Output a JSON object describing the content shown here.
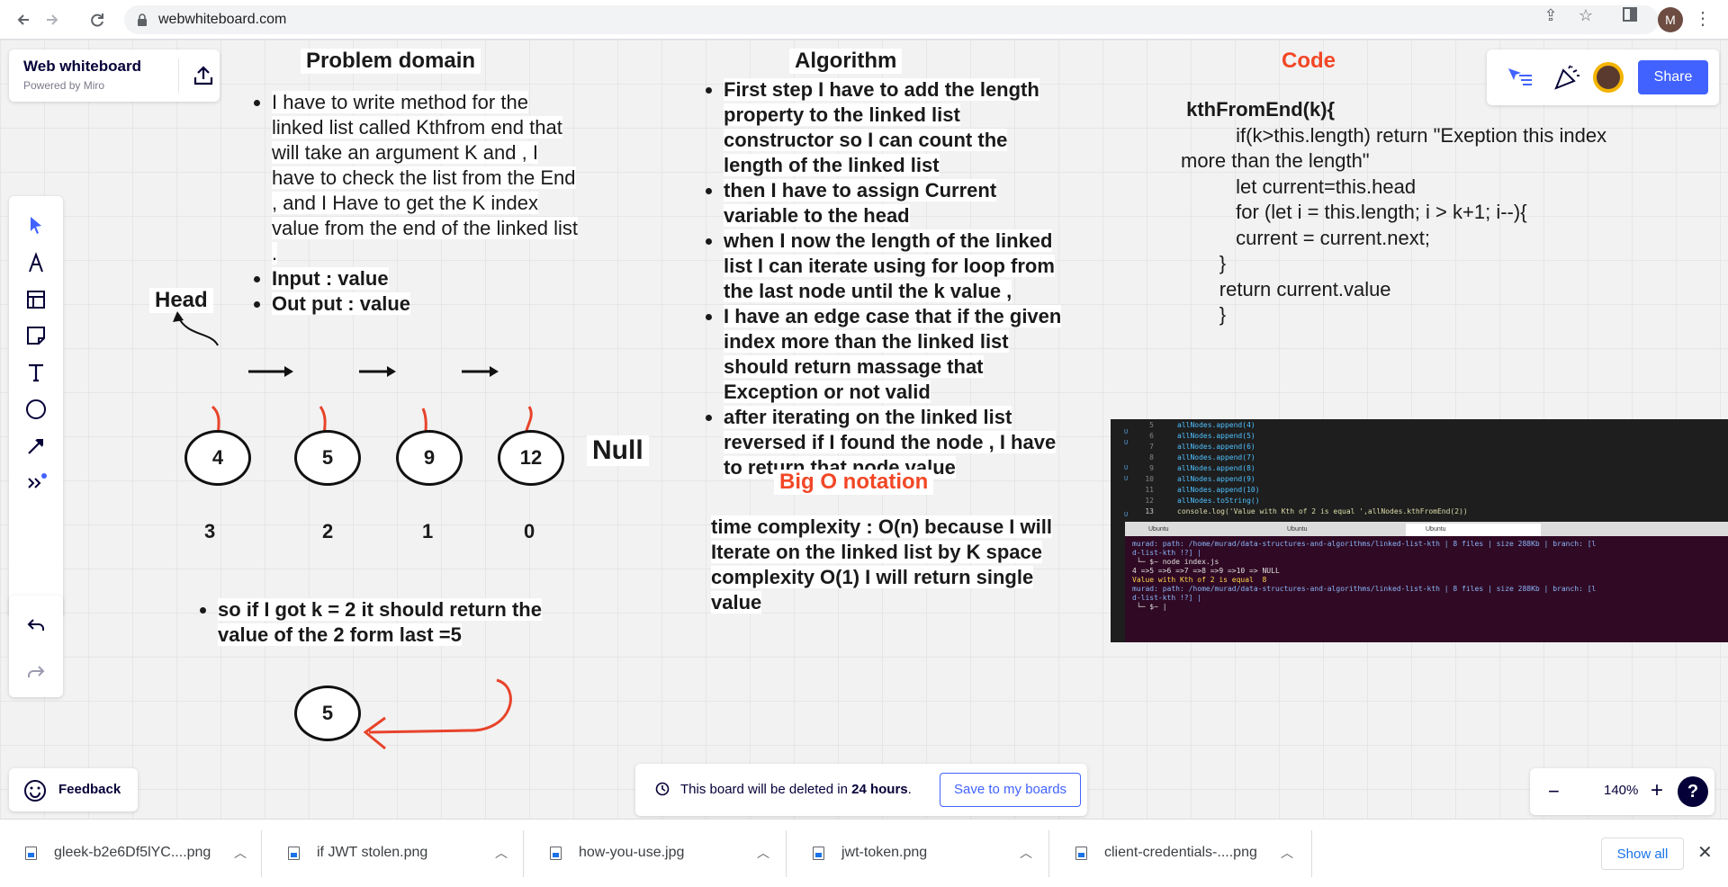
{
  "browser": {
    "url": "webwhiteboard.com",
    "profile_initial": "M"
  },
  "brand": {
    "title": "Web whiteboard",
    "subtitle": "Powered by Miro"
  },
  "collab": {
    "share_label": "Share"
  },
  "problem": {
    "heading": "Problem domain",
    "bullets": [
      "I have to write method for the linked list called Kthfrom end that will take an argument K and , I have to check the list from the End , and I Have to get the K index value from the end of the linked list .",
      "Input : value",
      "Out put : value"
    ],
    "head_label": "Head",
    "null_label": "Null",
    "nodes": [
      "4",
      "5",
      "9",
      "12"
    ],
    "indices": [
      "3",
      "2",
      "1",
      "0"
    ],
    "example": "so if I got k = 2 it should return the value of the 2 form last =5",
    "result_node": "5"
  },
  "algorithm": {
    "heading": "Algorithm",
    "bullets": [
      "First step I have to add the length property to  the linked list constructor so I can count the length of the linked list",
      "then I have to assign Current variable to the head",
      "when I now the length of the linked list I can iterate using for loop from the last node until the k value ,",
      "I have an edge case that if the given index more than the linked list should return massage that Exception or not valid",
      "after iterating on the linked list reversed  if I found the node , I have to return that node value"
    ]
  },
  "bigo": {
    "heading": "Big O notation",
    "text": "time complexity : O(n) because I will Iterate on the linked list by K space complexity O(1) I will return single value"
  },
  "code": {
    "heading": "Code",
    "lines": [
      " kthFromEnd(k){",
      "          if(k>this.length) return \"Exeption this index",
      "more than the length\"",
      "",
      "          let current=this.head",
      "          for (let i = this.length; i > k+1; i--){",
      "          current = current.next;",
      "       }",
      "       return current.value",
      "       }"
    ]
  },
  "terminal": {
    "code_lines": [
      {
        "n": "5",
        "t": "allNodes.append(4)"
      },
      {
        "n": "6",
        "t": "allNodes.append(5)"
      },
      {
        "n": "7",
        "t": "allNodes.append(6)"
      },
      {
        "n": "8",
        "t": "allNodes.append(7)"
      },
      {
        "n": "9",
        "t": "allNodes.append(8)"
      },
      {
        "n": "10",
        "t": "allNodes.append(9)"
      },
      {
        "n": "11",
        "t": "allNodes.append(10)"
      },
      {
        "n": "12",
        "t": "allNodes.toString()"
      },
      {
        "n": "13",
        "t": "console.log('Value with Kth of 2 is equal ',allNodes.kthFromEnd(2))"
      }
    ],
    "tabs": [
      "Ubuntu",
      "Ubuntu",
      "Ubuntu"
    ],
    "lines": [
      "murad: path: /home/murad/data-structures-and-algorithms/linked-list-kth | 8 files | size 288Kb | branch: [l",
      "d-list-kth !?] |",
      " └─ $~ node index.js",
      "4 =>5 =>6 =>7 =>8 =>9 =>10 => NULL",
      "Value with Kth of 2 is equal  8",
      "murad: path: /home/murad/data-structures-and-algorithms/linked-list-kth | 8 files | size 288Kb | branch: [l",
      "d-list-kth !?] |",
      " └─ $~ |"
    ]
  },
  "footer": {
    "feedback": "Feedback",
    "notice_prefix": "This board will be deleted in ",
    "notice_bold": "24 hours",
    "notice_suffix": ".",
    "save_button": "Save to my boards",
    "zoom": "140%"
  },
  "downloads": {
    "items": [
      "gleek-b2e6Df5lYC....png",
      "if JWT stolen.png",
      "how-you-use.jpg",
      "jwt-token.png",
      "client-credentials-....png"
    ],
    "show_all": "Show all"
  },
  "colors": {
    "accent": "#4262ff",
    "red_heading": "#f24726",
    "arrow_red": "#e8432b"
  }
}
